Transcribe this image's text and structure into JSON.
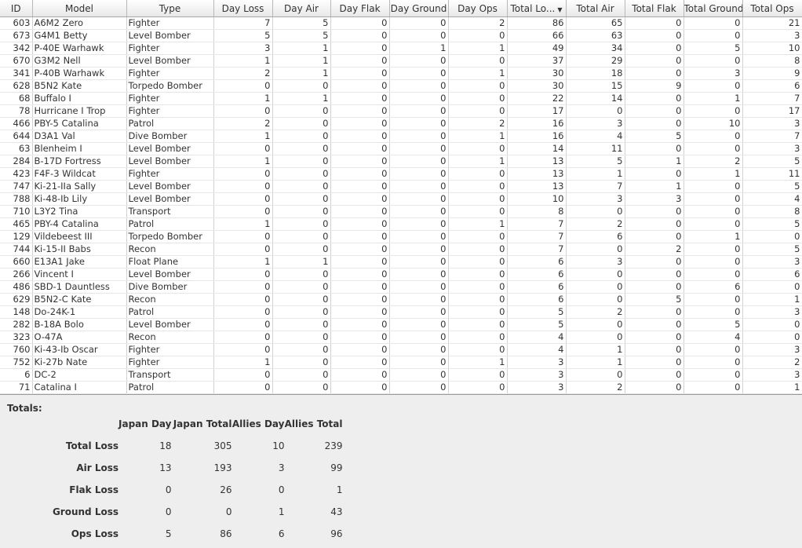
{
  "table": {
    "columns": [
      "ID",
      "Model",
      "Type",
      "Day Loss",
      "Day Air",
      "Day Flak",
      "Day Ground",
      "Day Ops",
      "Total Lo...",
      "Total Air",
      "Total Flak",
      "Total Ground",
      "Total Ops"
    ],
    "sort_column": 8,
    "rows": [
      [
        "603",
        "A6M2 Zero",
        "Fighter",
        "7",
        "5",
        "0",
        "0",
        "2",
        "86",
        "65",
        "0",
        "0",
        "21"
      ],
      [
        "673",
        "G4M1 Betty",
        "Level Bomber",
        "5",
        "5",
        "0",
        "0",
        "0",
        "66",
        "63",
        "0",
        "0",
        "3"
      ],
      [
        "342",
        "P-40E Warhawk",
        "Fighter",
        "3",
        "1",
        "0",
        "1",
        "1",
        "49",
        "34",
        "0",
        "5",
        "10"
      ],
      [
        "670",
        "G3M2 Nell",
        "Level Bomber",
        "1",
        "1",
        "0",
        "0",
        "0",
        "37",
        "29",
        "0",
        "0",
        "8"
      ],
      [
        "341",
        "P-40B Warhawk",
        "Fighter",
        "2",
        "1",
        "0",
        "0",
        "1",
        "30",
        "18",
        "0",
        "3",
        "9"
      ],
      [
        "628",
        "B5N2 Kate",
        "Torpedo Bomber",
        "0",
        "0",
        "0",
        "0",
        "0",
        "30",
        "15",
        "9",
        "0",
        "6"
      ],
      [
        "68",
        "Buffalo I",
        "Fighter",
        "1",
        "1",
        "0",
        "0",
        "0",
        "22",
        "14",
        "0",
        "1",
        "7"
      ],
      [
        "78",
        "Hurricane I Trop",
        "Fighter",
        "0",
        "0",
        "0",
        "0",
        "0",
        "17",
        "0",
        "0",
        "0",
        "17"
      ],
      [
        "466",
        "PBY-5 Catalina",
        "Patrol",
        "2",
        "0",
        "0",
        "0",
        "2",
        "16",
        "3",
        "0",
        "10",
        "3"
      ],
      [
        "644",
        "D3A1 Val",
        "Dive Bomber",
        "1",
        "0",
        "0",
        "0",
        "1",
        "16",
        "4",
        "5",
        "0",
        "7"
      ],
      [
        "63",
        "Blenheim I",
        "Level Bomber",
        "0",
        "0",
        "0",
        "0",
        "0",
        "14",
        "11",
        "0",
        "0",
        "3"
      ],
      [
        "284",
        "B-17D Fortress",
        "Level Bomber",
        "1",
        "0",
        "0",
        "0",
        "1",
        "13",
        "5",
        "1",
        "2",
        "5"
      ],
      [
        "423",
        "F4F-3 Wildcat",
        "Fighter",
        "0",
        "0",
        "0",
        "0",
        "0",
        "13",
        "1",
        "0",
        "1",
        "11"
      ],
      [
        "747",
        "Ki-21-IIa Sally",
        "Level Bomber",
        "0",
        "0",
        "0",
        "0",
        "0",
        "13",
        "7",
        "1",
        "0",
        "5"
      ],
      [
        "788",
        "Ki-48-Ib Lily",
        "Level Bomber",
        "0",
        "0",
        "0",
        "0",
        "0",
        "10",
        "3",
        "3",
        "0",
        "4"
      ],
      [
        "710",
        "L3Y2 Tina",
        "Transport",
        "0",
        "0",
        "0",
        "0",
        "0",
        "8",
        "0",
        "0",
        "0",
        "8"
      ],
      [
        "465",
        "PBY-4 Catalina",
        "Patrol",
        "1",
        "0",
        "0",
        "0",
        "1",
        "7",
        "2",
        "0",
        "0",
        "5"
      ],
      [
        "129",
        "Vildebeest III",
        "Torpedo Bomber",
        "0",
        "0",
        "0",
        "0",
        "0",
        "7",
        "6",
        "0",
        "1",
        "0"
      ],
      [
        "744",
        "Ki-15-II Babs",
        "Recon",
        "0",
        "0",
        "0",
        "0",
        "0",
        "7",
        "0",
        "2",
        "0",
        "5"
      ],
      [
        "660",
        "E13A1 Jake",
        "Float Plane",
        "1",
        "1",
        "0",
        "0",
        "0",
        "6",
        "3",
        "0",
        "0",
        "3"
      ],
      [
        "266",
        "Vincent I",
        "Level Bomber",
        "0",
        "0",
        "0",
        "0",
        "0",
        "6",
        "0",
        "0",
        "0",
        "6"
      ],
      [
        "486",
        "SBD-1 Dauntless",
        "Dive Bomber",
        "0",
        "0",
        "0",
        "0",
        "0",
        "6",
        "0",
        "0",
        "6",
        "0"
      ],
      [
        "629",
        "B5N2-C Kate",
        "Recon",
        "0",
        "0",
        "0",
        "0",
        "0",
        "6",
        "0",
        "5",
        "0",
        "1"
      ],
      [
        "148",
        "Do-24K-1",
        "Patrol",
        "0",
        "0",
        "0",
        "0",
        "0",
        "5",
        "2",
        "0",
        "0",
        "3"
      ],
      [
        "282",
        "B-18A Bolo",
        "Level Bomber",
        "0",
        "0",
        "0",
        "0",
        "0",
        "5",
        "0",
        "0",
        "5",
        "0"
      ],
      [
        "323",
        "O-47A",
        "Recon",
        "0",
        "0",
        "0",
        "0",
        "0",
        "4",
        "0",
        "0",
        "4",
        "0"
      ],
      [
        "760",
        "Ki-43-Ib Oscar",
        "Fighter",
        "0",
        "0",
        "0",
        "0",
        "0",
        "4",
        "1",
        "0",
        "0",
        "3"
      ],
      [
        "752",
        "Ki-27b Nate",
        "Fighter",
        "1",
        "0",
        "0",
        "0",
        "1",
        "3",
        "1",
        "0",
        "0",
        "2"
      ],
      [
        "6",
        "DC-2",
        "Transport",
        "0",
        "0",
        "0",
        "0",
        "0",
        "3",
        "0",
        "0",
        "0",
        "3"
      ],
      [
        "71",
        "Catalina I",
        "Patrol",
        "0",
        "0",
        "0",
        "0",
        "0",
        "3",
        "2",
        "0",
        "0",
        "1"
      ]
    ]
  },
  "totals": {
    "title": "Totals:",
    "headers": [
      "Japan Day",
      "Japan Total",
      "Allies Day",
      "Allies Total"
    ],
    "rows": [
      {
        "label": "Total Loss",
        "values": [
          "18",
          "305",
          "10",
          "239"
        ]
      },
      {
        "label": "Air Loss",
        "values": [
          "13",
          "193",
          "3",
          "99"
        ]
      },
      {
        "label": "Flak Loss",
        "values": [
          "0",
          "26",
          "0",
          "1"
        ]
      },
      {
        "label": "Ground Loss",
        "values": [
          "0",
          "0",
          "1",
          "43"
        ]
      },
      {
        "label": "Ops Loss",
        "values": [
          "5",
          "86",
          "6",
          "96"
        ]
      }
    ]
  }
}
